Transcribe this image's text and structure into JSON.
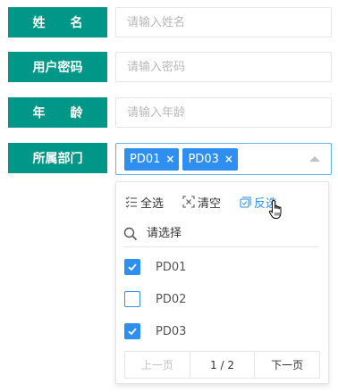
{
  "form": {
    "name": {
      "label_chars": [
        "姓",
        "名"
      ],
      "placeholder": "请输入姓名"
    },
    "password": {
      "label": "用户密码",
      "placeholder": "请输入密码"
    },
    "age": {
      "label_chars": [
        "年",
        "龄"
      ],
      "placeholder": "请输入年龄"
    },
    "department": {
      "label": "所属部门",
      "selected_tags": [
        {
          "label": "PD01",
          "remove": "×"
        },
        {
          "label": "PD03",
          "remove": "×"
        }
      ]
    }
  },
  "dropdown": {
    "toolbar": {
      "select_all": "全选",
      "clear": "清空",
      "inverse": "反选"
    },
    "search_placeholder": "请选择",
    "options": [
      {
        "label": "PD01",
        "checked": true
      },
      {
        "label": "PD02",
        "checked": false
      },
      {
        "label": "PD03",
        "checked": true
      }
    ],
    "pager": {
      "prev": "上一页",
      "current": "1 / 2",
      "next": "下一页"
    }
  },
  "colors": {
    "label_bg": "#009688",
    "accent": "#2f8ff0",
    "border": "#e6e6e6",
    "focus_border": "#5fb4f0"
  },
  "icons": {
    "select_all": "checklist-icon",
    "clear": "clear-icon",
    "inverse": "inverse-icon",
    "search": "search-icon",
    "arrow": "caret-up-icon",
    "cursor": "hand-pointer-icon"
  }
}
